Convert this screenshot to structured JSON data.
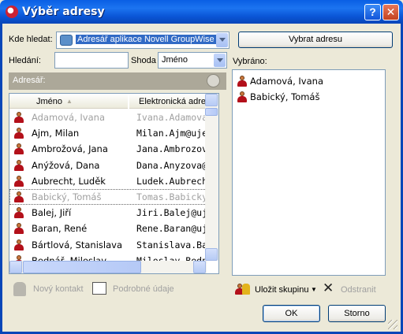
{
  "window": {
    "title": "Výběr adresy"
  },
  "lookin": {
    "label": "Kde hledat:",
    "value": "Adresář aplikace Novell GroupWise"
  },
  "select_button": "Vybrat adresu",
  "search": {
    "label": "Hledání:",
    "value": ""
  },
  "match": {
    "label": "Shoda",
    "value": "Jméno"
  },
  "selected_label": "Vybráno:",
  "addressbook_label": "Adresář:",
  "columns": {
    "name": "Jméno",
    "email": "Elektronická adresa"
  },
  "rows": [
    {
      "name": "Adamová, Ivana",
      "email": "Ivana.Adamova@",
      "dim": true
    },
    {
      "name": "Ajm, Milan",
      "email": "Milan.Ajm@uje",
      "dim": false
    },
    {
      "name": "Ambrožová, Jana",
      "email": "Jana.Ambrozov",
      "dim": false
    },
    {
      "name": "Anýžová, Dana",
      "email": "Dana.Anyzova@",
      "dim": false
    },
    {
      "name": "Aubrecht, Luděk",
      "email": "Ludek.Aubrecht",
      "dim": false
    },
    {
      "name": "Babický, Tomáš",
      "email": "Tomas.Babicky",
      "dim": true
    },
    {
      "name": "Balej, Jiří",
      "email": "Jiri.Balej@ujep",
      "dim": false
    },
    {
      "name": "Baran, René",
      "email": "Rene.Baran@uj",
      "dim": false
    },
    {
      "name": "Bártlová, Stanislava",
      "email": "Stanislava.Bart",
      "dim": false
    },
    {
      "name": "Bednář, Miloslav",
      "email": "Miloslav.Bednar",
      "dim": false
    }
  ],
  "selected": [
    {
      "name": "Adamová, Ivana"
    },
    {
      "name": "Babický, Tomáš"
    }
  ],
  "actions": {
    "new_contact": "Nový kontakt",
    "details": "Podrobné údaje",
    "save_group": "Uložit skupinu",
    "remove": "Odstranit"
  },
  "buttons": {
    "ok": "OK",
    "cancel": "Storno"
  }
}
